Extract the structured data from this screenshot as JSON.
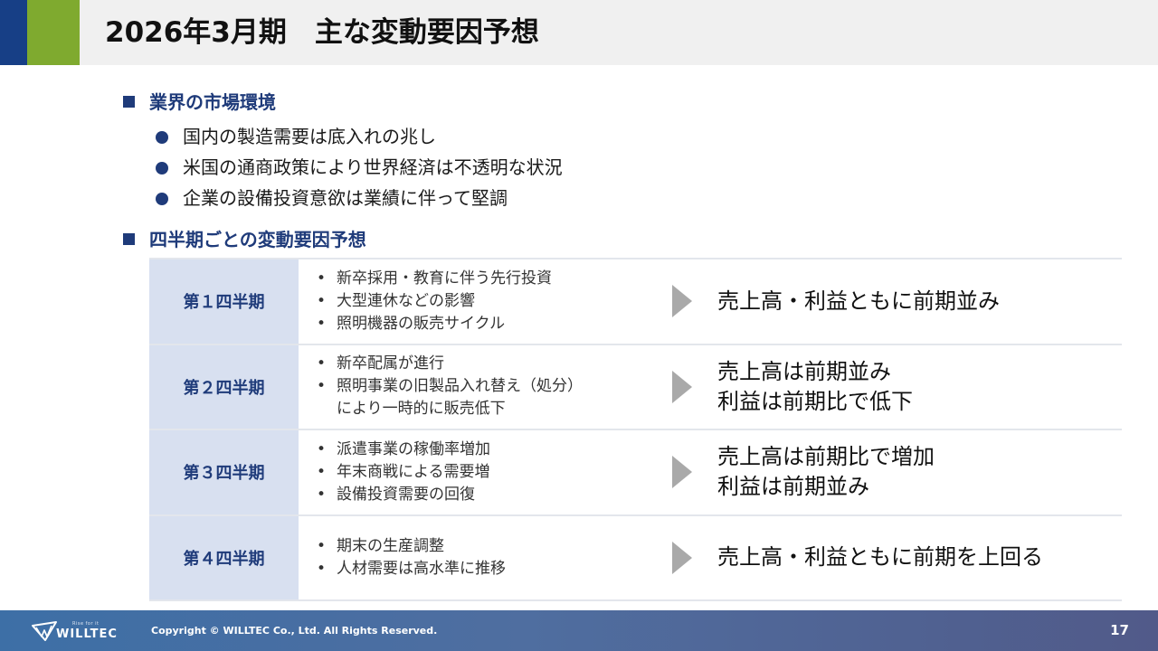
{
  "header": {
    "title": "2026年3月期　主な変動要因予想",
    "colors": {
      "accent_blue": "#173f86",
      "accent_green": "#7faa2f"
    }
  },
  "market": {
    "heading": "業界の市場環境",
    "items": [
      "国内の製造需要は底入れの兆し",
      "米国の通商政策により世界経済は不透明な状況",
      "企業の設備投資意欲は業績に伴って堅調"
    ]
  },
  "quarters": {
    "heading": "四半期ごとの変動要因予想",
    "rows": [
      {
        "label": "第１四半期",
        "points": [
          "新卒採用・教育に伴う先行投資",
          "大型連休などの影響",
          "照明機器の販売サイクル"
        ],
        "result": [
          "売上高・利益ともに前期並み"
        ]
      },
      {
        "label": "第２四半期",
        "points": [
          "新卒配属が進行",
          "照明事業の旧製品入れ替え（処分）",
          "により一時的に販売低下"
        ],
        "result": [
          "売上高は前期並み",
          "利益は前期比で低下"
        ]
      },
      {
        "label": "第３四半期",
        "points": [
          "派遣事業の稼働率増加",
          "年末商戦による需要増",
          "設備投資需要の回復"
        ],
        "result": [
          "売上高は前期比で増加",
          "利益は前期並み"
        ]
      },
      {
        "label": "第４四半期",
        "points": [
          "期末の生産調整",
          "人材需要は高水準に推移"
        ],
        "result": [
          "売上高・利益ともに前期を上回る"
        ]
      }
    ]
  },
  "footer": {
    "logo_tagline": "Rise for it",
    "logo_name": "WILLTEC",
    "copyright": "Copyright © WILLTEC Co., Ltd. All Rights Reserved.",
    "page_number": "17"
  }
}
